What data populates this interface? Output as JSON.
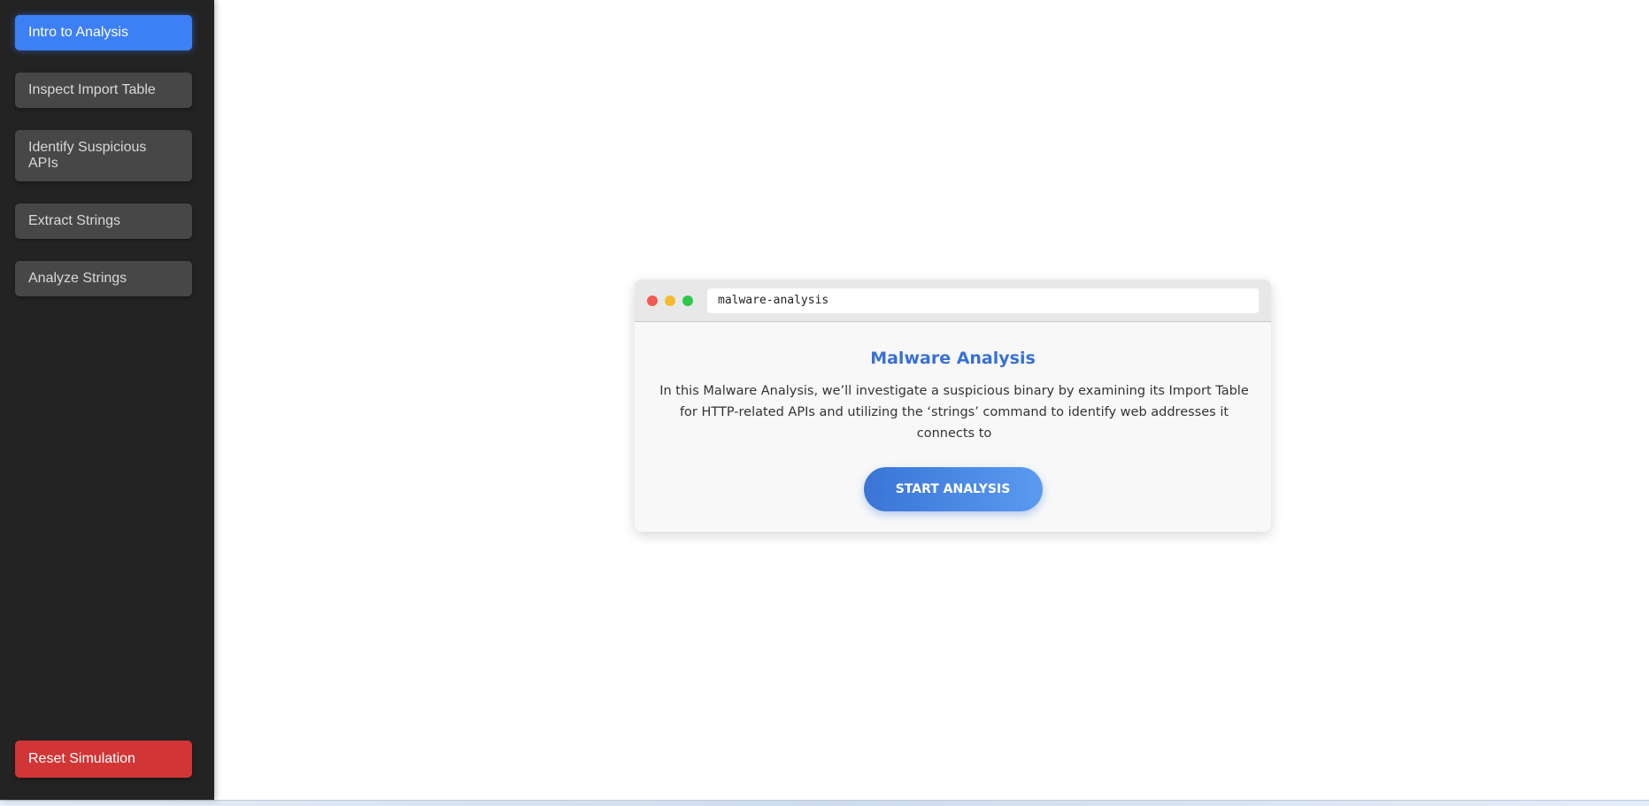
{
  "sidebar": {
    "items": [
      {
        "label": "Intro to Analysis",
        "active": true
      },
      {
        "label": "Inspect Import Table",
        "active": false
      },
      {
        "label": "Identify Suspicious APIs",
        "active": false
      },
      {
        "label": "Extract Strings",
        "active": false
      },
      {
        "label": "Analyze Strings",
        "active": false
      }
    ],
    "reset_label": "Reset Simulation"
  },
  "window": {
    "address": "malware-analysis",
    "title": "Malware Analysis",
    "description": "In this Malware Analysis, we’ll investigate a suspicious binary by examining its Import Table for HTTP-related APIs and utilizing the ‘strings’ command to identify web addresses it connects to",
    "start_label": "START ANALYSIS"
  },
  "colors": {
    "sidebar_bg": "#232323",
    "active_item": "#3d7ff5",
    "inactive_item": "#474747",
    "reset": "#d13535",
    "title_blue": "#3871d6"
  }
}
